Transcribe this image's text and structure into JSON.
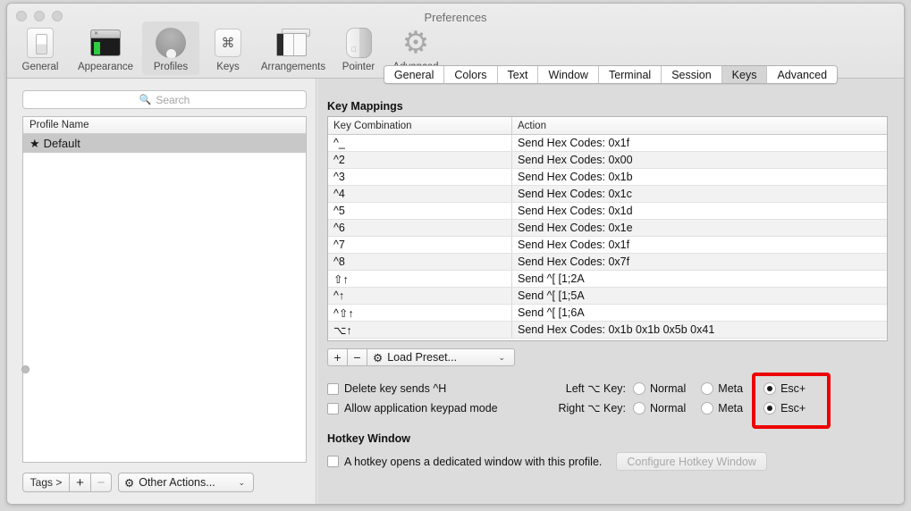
{
  "window": {
    "title": "Preferences"
  },
  "toolbar": {
    "items": [
      {
        "label": "General",
        "icon": "general-icon"
      },
      {
        "label": "Appearance",
        "icon": "appearance-icon"
      },
      {
        "label": "Profiles",
        "icon": "profiles-icon"
      },
      {
        "label": "Keys",
        "icon": "command-key-icon"
      },
      {
        "label": "Arrangements",
        "icon": "arrangements-icon"
      },
      {
        "label": "Pointer",
        "icon": "pointer-icon"
      },
      {
        "label": "Advanced",
        "icon": "gear-icon"
      }
    ],
    "selected": "Profiles"
  },
  "sidebar": {
    "search": {
      "placeholder": "Search",
      "value": "",
      "icon": "search-icon"
    },
    "table": {
      "header": "Profile Name",
      "rows": [
        {
          "star": "★",
          "name": "Default",
          "selected": true
        }
      ]
    },
    "buttons": {
      "tags": "Tags >",
      "add": "+",
      "remove": "−",
      "other_actions": "Other Actions...",
      "other_actions_icon": "gear-icon",
      "chevron": "⌄"
    }
  },
  "tabs": {
    "items": [
      "General",
      "Colors",
      "Text",
      "Window",
      "Terminal",
      "Session",
      "Keys",
      "Advanced"
    ],
    "active": "Keys"
  },
  "key_mappings": {
    "title": "Key Mappings",
    "columns": [
      "Key Combination",
      "Action"
    ],
    "rows": [
      {
        "combo": "^_",
        "action": "Send Hex Codes: 0x1f"
      },
      {
        "combo": "^2",
        "action": "Send Hex Codes: 0x00"
      },
      {
        "combo": "^3",
        "action": "Send Hex Codes: 0x1b"
      },
      {
        "combo": "^4",
        "action": "Send Hex Codes: 0x1c"
      },
      {
        "combo": "^5",
        "action": "Send Hex Codes: 0x1d"
      },
      {
        "combo": "^6",
        "action": "Send Hex Codes: 0x1e"
      },
      {
        "combo": "^7",
        "action": "Send Hex Codes: 0x1f"
      },
      {
        "combo": "^8",
        "action": "Send Hex Codes: 0x7f"
      },
      {
        "combo": "⇧↑",
        "action": "Send ^[ [1;2A"
      },
      {
        "combo": "^↑",
        "action": "Send ^[ [1;5A"
      },
      {
        "combo": "^⇧↑",
        "action": "Send ^[ [1;6A"
      },
      {
        "combo": "⌥↑",
        "action": "Send Hex Codes: 0x1b 0x1b 0x5b 0x41"
      }
    ],
    "toolbar": {
      "add": "+",
      "remove": "−",
      "load_preset": "Load Preset...",
      "load_preset_icon": "gear-icon",
      "chevron": "⌄"
    },
    "checkboxes": [
      {
        "label": "Delete key sends ^H",
        "checked": false
      },
      {
        "label": "Allow application keypad mode",
        "checked": false
      }
    ],
    "option_rows": [
      {
        "label": "Left ⌥ Key:",
        "options": [
          {
            "label": "Normal",
            "selected": false
          },
          {
            "label": "Meta",
            "selected": false
          },
          {
            "label": "Esc+",
            "selected": true
          }
        ]
      },
      {
        "label": "Right ⌥ Key:",
        "options": [
          {
            "label": "Normal",
            "selected": false
          },
          {
            "label": "Meta",
            "selected": false
          },
          {
            "label": "Esc+",
            "selected": true
          }
        ]
      }
    ]
  },
  "hotkey_window": {
    "title": "Hotkey Window",
    "checkbox": {
      "label": "A hotkey opens a dedicated window with this profile.",
      "checked": false
    },
    "button": {
      "label": "Configure Hotkey Window",
      "enabled": false
    }
  },
  "annotation": {
    "highlight_color": "#ee0000",
    "target": "Esc+ radio buttons"
  }
}
